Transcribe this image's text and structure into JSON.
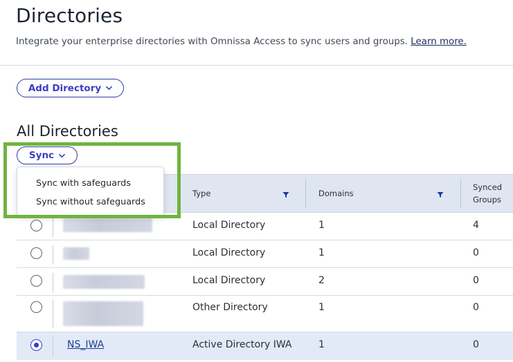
{
  "header": {
    "title": "Directories",
    "description": "Integrate your enterprise directories with Omnissa Access to sync users and groups.",
    "learn_more": "Learn more."
  },
  "toolbar": {
    "add_directory_label": "Add Directory"
  },
  "section": {
    "title": "All Directories",
    "sync_label": "Sync"
  },
  "sync_menu": {
    "items": [
      "Sync with safeguards",
      "Sync without safeguards"
    ]
  },
  "table": {
    "columns": {
      "type": "Type",
      "domains": "Domains",
      "synced_groups": [
        "Synced",
        "Groups"
      ]
    },
    "rows": [
      {
        "name": "",
        "type": "Local Directory",
        "domains": "1",
        "synced_groups": "4",
        "selected": false
      },
      {
        "name": "",
        "type": "Local Directory",
        "domains": "1",
        "synced_groups": "0",
        "selected": false
      },
      {
        "name": "",
        "type": "Local Directory",
        "domains": "2",
        "synced_groups": "0",
        "selected": false
      },
      {
        "name": "",
        "type": "Other Directory",
        "domains": "1",
        "synced_groups": "0",
        "selected": false
      },
      {
        "name": "NS_IWA",
        "type": "Active Directory IWA",
        "domains": "1",
        "synced_groups": "0",
        "selected": true
      }
    ]
  },
  "colors": {
    "accent": "#3b3fc2",
    "highlight": "#6fb43f",
    "header_bg": "#dfe6f2",
    "selected_row_bg": "#e3eaf7"
  }
}
